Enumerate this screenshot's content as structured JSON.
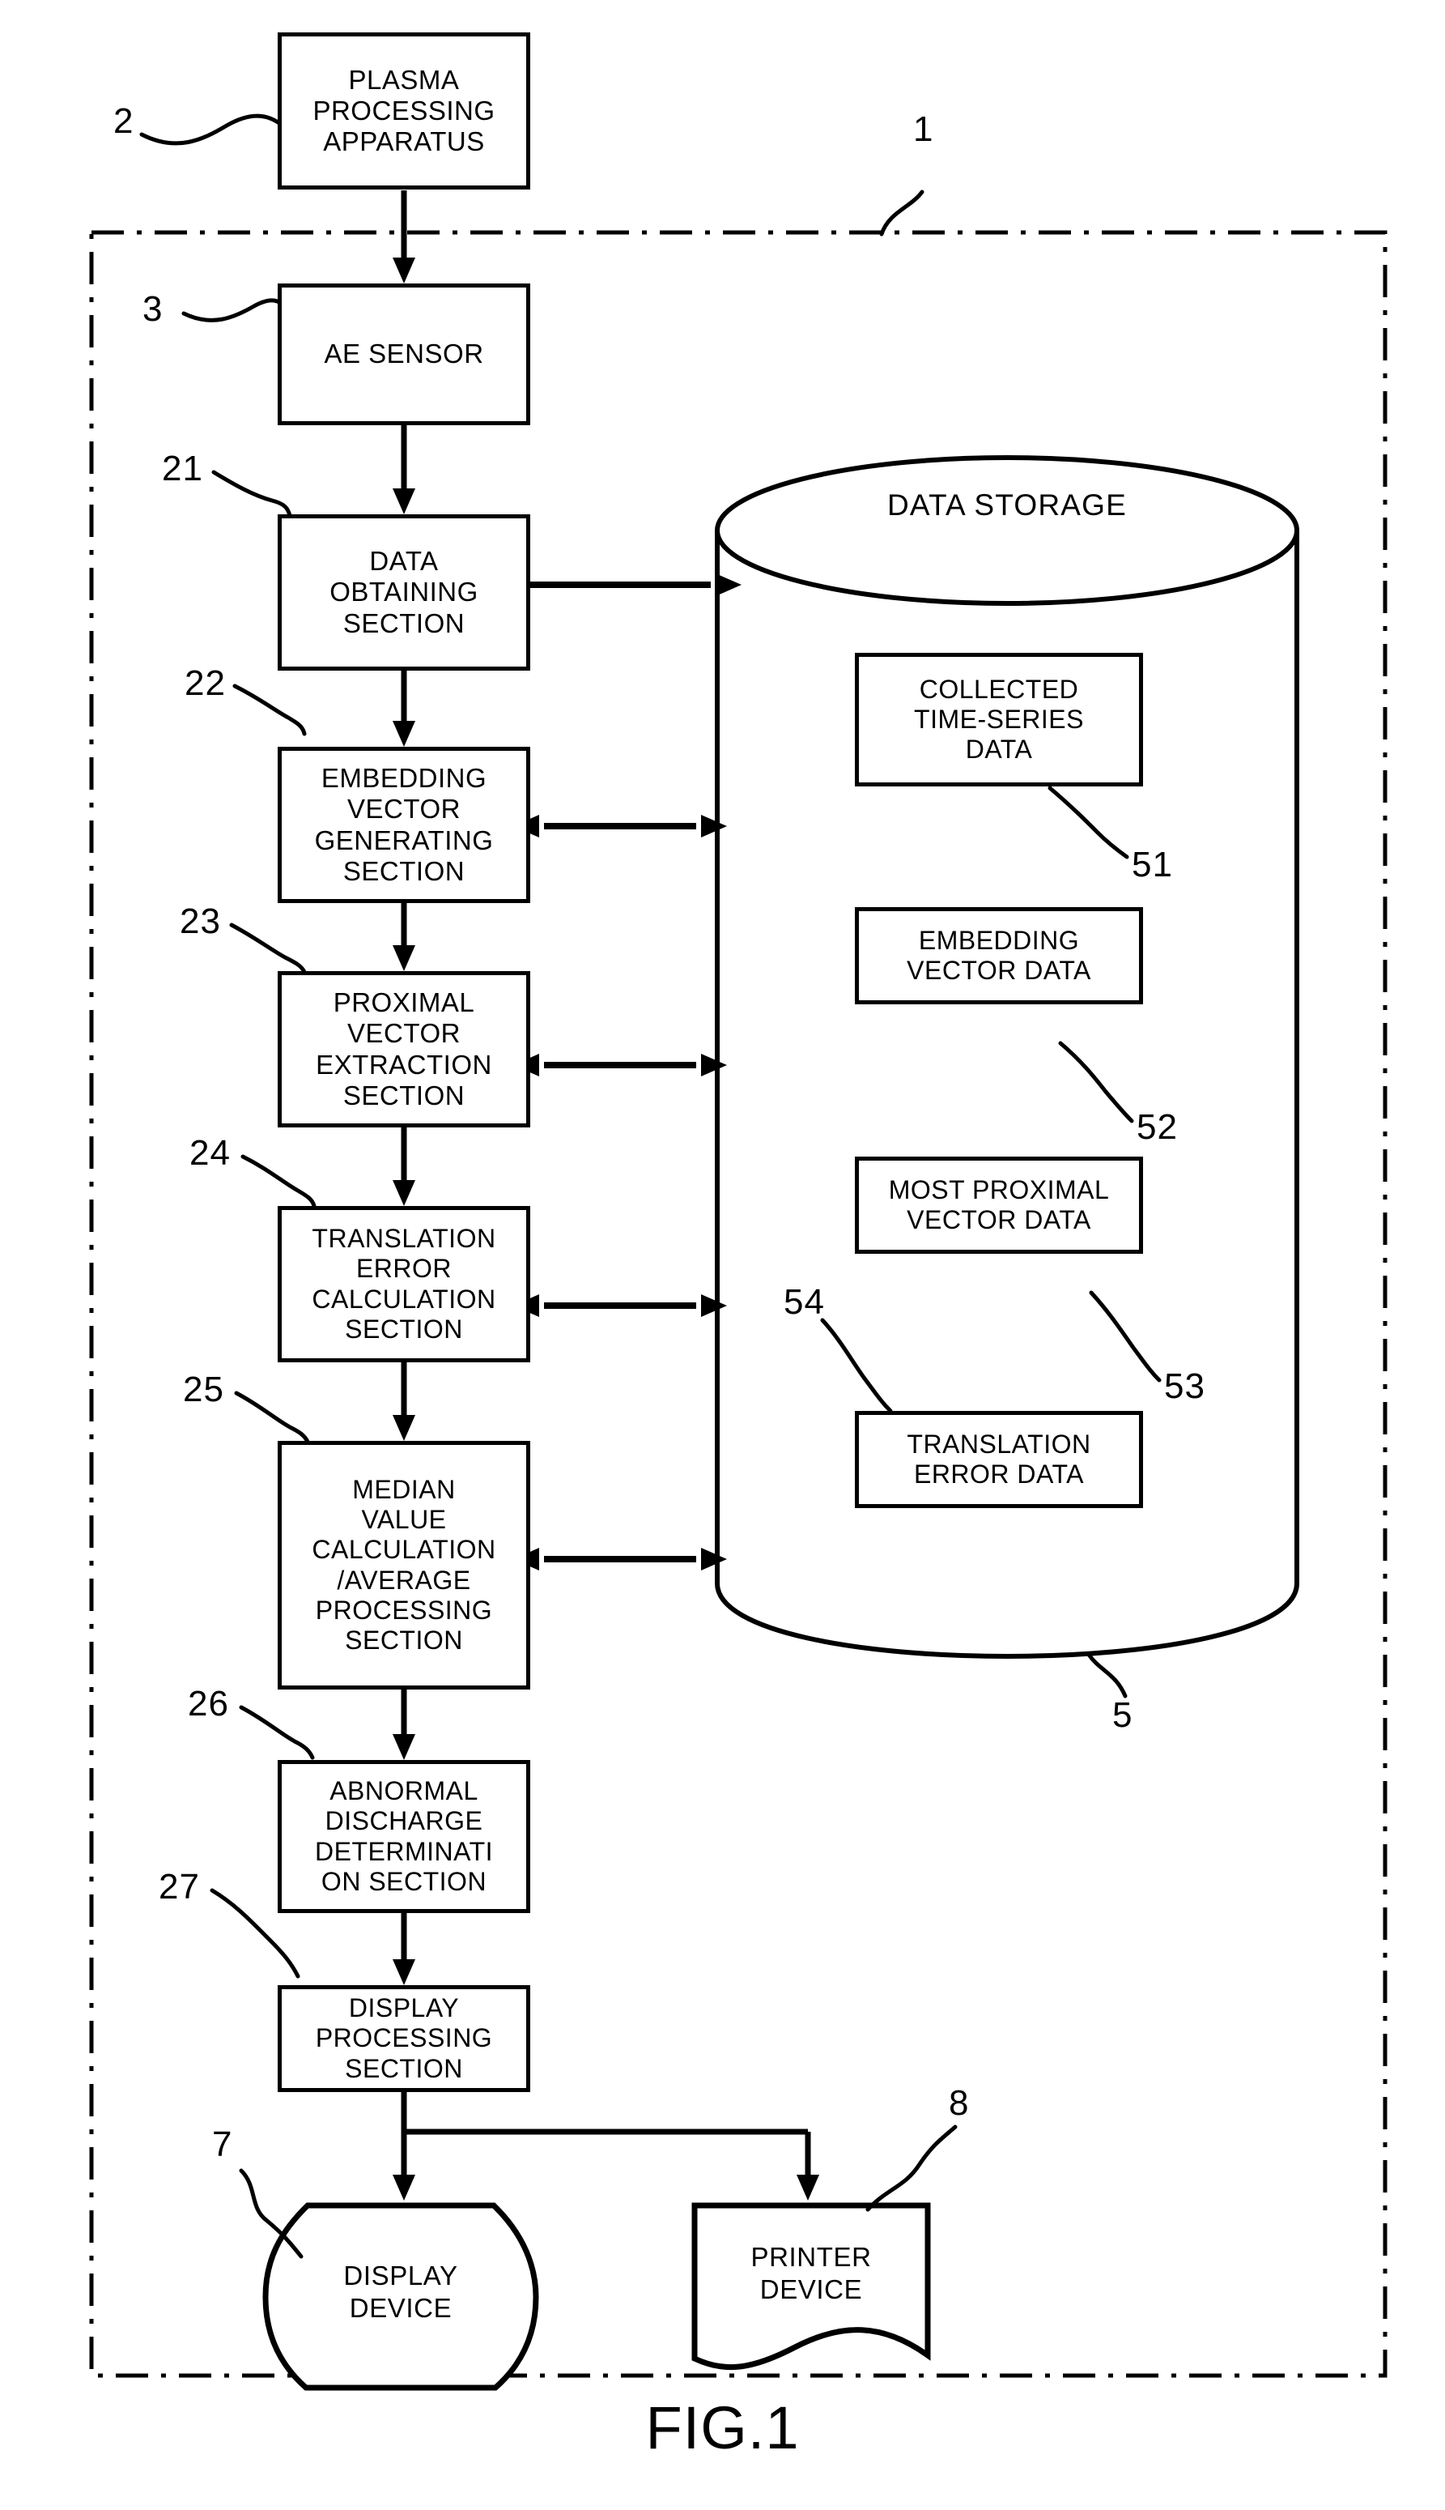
{
  "figure": {
    "caption": "FIG.1",
    "system_ref": "1"
  },
  "external": {
    "plasma_apparatus": {
      "label": "PLASMA\nPROCESSING\nAPPARATUS",
      "ref": "2"
    }
  },
  "sensor": {
    "ae_sensor": {
      "label": "AE SENSOR",
      "ref": "3"
    }
  },
  "process_chain": [
    {
      "label": "DATA\nOBTAINING\nSECTION",
      "ref": "21"
    },
    {
      "label": "EMBEDDING\nVECTOR\nGENERATING\nSECTION",
      "ref": "22"
    },
    {
      "label": "PROXIMAL\nVECTOR\nEXTRACTION\nSECTION",
      "ref": "23"
    },
    {
      "label": "TRANSLATION\nERROR\nCALCULATION\nSECTION",
      "ref": "24"
    },
    {
      "label": "MEDIAN\nVALUE\nCALCULATION\n/AVERAGE\nPROCESSING\nSECTION",
      "ref": "25"
    },
    {
      "label": "ABNORMAL\nDISCHARGE\nDETERMINATI\nON SECTION",
      "ref": "26"
    },
    {
      "label": "DISPLAY\nPROCESSING\nSECTION",
      "ref": "27"
    }
  ],
  "storage": {
    "title": "DATA STORAGE",
    "ref": "5",
    "items": [
      {
        "label": "COLLECTED\nTIME-SERIES\nDATA",
        "ref": "51"
      },
      {
        "label": "EMBEDDING\nVECTOR DATA",
        "ref": "52"
      },
      {
        "label": "MOST PROXIMAL\nVECTOR DATA",
        "ref": "53"
      },
      {
        "label": "TRANSLATION\nERROR DATA",
        "ref": "54"
      }
    ]
  },
  "outputs": [
    {
      "label": "DISPLAY\nDEVICE",
      "ref": "7"
    },
    {
      "label": "PRINTER\nDEVICE",
      "ref": "8"
    }
  ],
  "colors": {
    "ink": "#000000",
    "paper": "#ffffff"
  }
}
